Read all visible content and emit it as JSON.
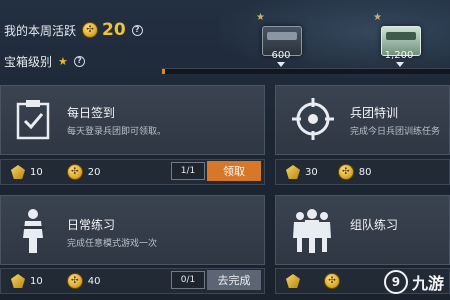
{
  "header": {
    "weekly_activity_label": "我的本周活跃",
    "weekly_activity_value": "20",
    "chest_level_label": "宝箱级别"
  },
  "progress": {
    "fraction": 0.01
  },
  "chests": [
    {
      "value": "600",
      "style": "gray"
    },
    {
      "value": "1,200",
      "style": "green"
    }
  ],
  "tasks": [
    {
      "title": "每日签到",
      "desc": "每天登录兵团即可领取。",
      "icon": "clipboard-check-icon",
      "rewards": [
        {
          "icon": "gem-icon",
          "value": "10"
        },
        {
          "icon": "coin-icon",
          "value": "20"
        }
      ],
      "count": "1/1",
      "button": "领取",
      "button_state": "claim"
    },
    {
      "title": "兵团特训",
      "desc": "完成今日兵团训练任务",
      "icon": "crosshair-icon",
      "rewards": [
        {
          "icon": "gem-icon",
          "value": "30"
        },
        {
          "icon": "coin-icon",
          "value": "80"
        }
      ]
    },
    {
      "title": "日常练习",
      "desc": "完成任意模式游戏一次",
      "icon": "soldier-icon",
      "rewards": [
        {
          "icon": "gem-icon",
          "value": "10"
        },
        {
          "icon": "coin-icon",
          "value": "40"
        }
      ],
      "count": "0/1",
      "button": "去完成",
      "button_state": "go"
    },
    {
      "title": "组队练习",
      "icon": "squad-icon",
      "rewards": [
        {
          "icon": "gem-icon",
          "value": ""
        },
        {
          "icon": "coin-icon",
          "value": ""
        }
      ]
    }
  ],
  "watermark": {
    "text": "九游"
  },
  "colors": {
    "accent": "#d7772a",
    "gold": "#f2c233",
    "panel": "#3a4350"
  }
}
